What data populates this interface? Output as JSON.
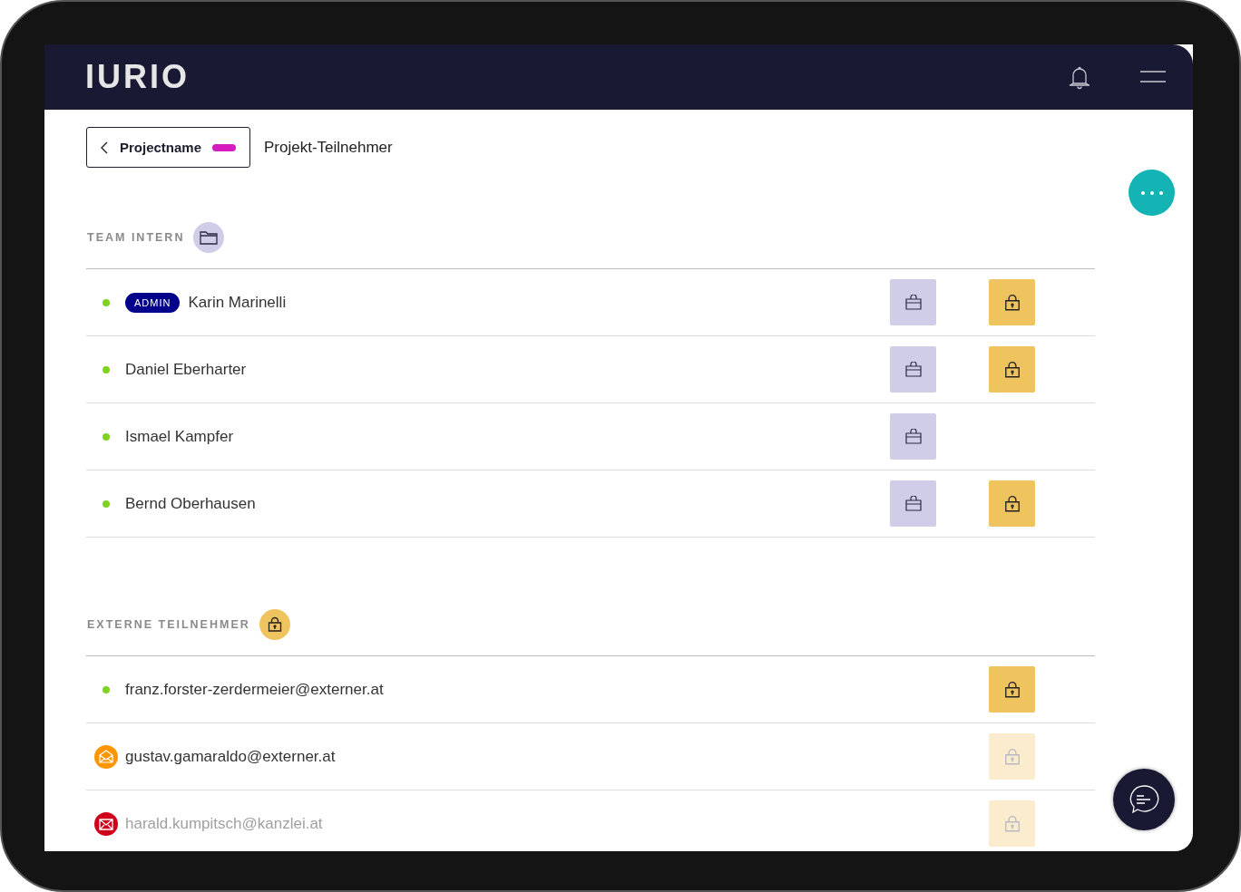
{
  "header": {
    "logo": "IURIO"
  },
  "breadcrumb": {
    "back_label": "Projectname",
    "color": "#d61bbf",
    "page_title": "Projekt-Teilnehmer"
  },
  "sections": [
    {
      "title": "TEAM INTERN",
      "kind": "team",
      "members": [
        {
          "name": "Karin Marinelli",
          "kind": "online",
          "badge": "ADMIN",
          "muted": false,
          "team_access": true,
          "extern_access": true,
          "extern_faded": false
        },
        {
          "name": "Daniel Eberharter",
          "kind": "online",
          "muted": false,
          "team_access": true,
          "extern_access": true,
          "extern_faded": false
        },
        {
          "name": "Ismael Kampfer",
          "kind": "online",
          "muted": false,
          "team_access": true,
          "extern_access": false
        },
        {
          "name": "Bernd Oberhausen",
          "kind": "online",
          "muted": false,
          "team_access": true,
          "extern_access": true,
          "extern_faded": false
        }
      ]
    },
    {
      "title": "EXTERNE TEILNEHMER",
      "kind": "extern",
      "members": [
        {
          "name": "franz.forster-zerdermeier@externer.at",
          "kind": "online",
          "muted": false,
          "team_access": false,
          "extern_access": true,
          "extern_faded": false
        },
        {
          "name": "gustav.gamaraldo@externer.at",
          "kind": "invited",
          "muted": false,
          "team_access": false,
          "extern_access": true,
          "extern_faded": true
        },
        {
          "name": "harald.kumpitsch@kanzlei.at",
          "kind": "bounced",
          "muted": true,
          "team_access": false,
          "extern_access": true,
          "extern_faded": true
        }
      ]
    }
  ]
}
